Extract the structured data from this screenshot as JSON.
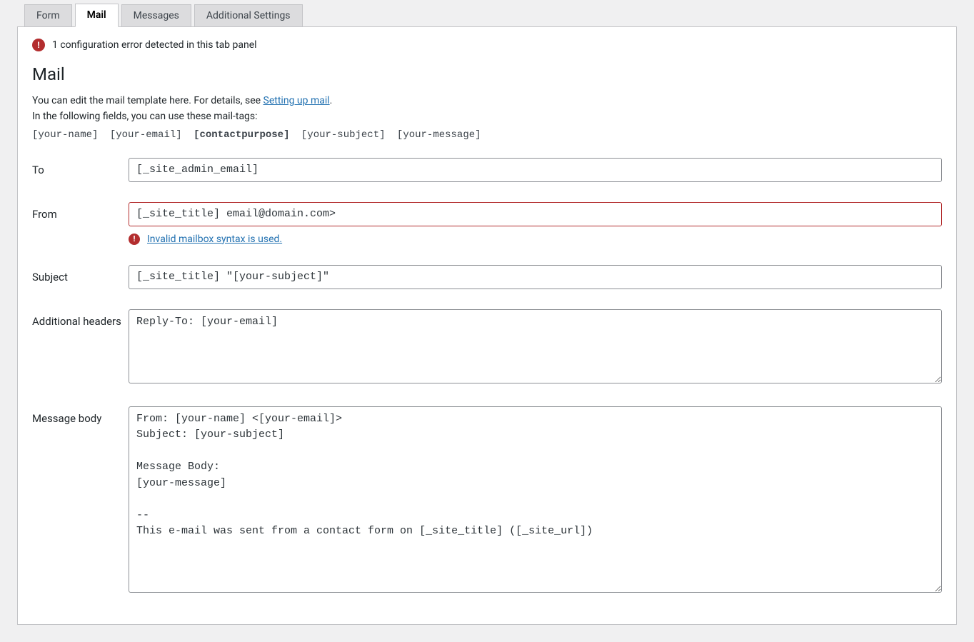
{
  "tabs": [
    {
      "label": "Form",
      "active": false
    },
    {
      "label": "Mail",
      "active": true
    },
    {
      "label": "Messages",
      "active": false
    },
    {
      "label": "Additional Settings",
      "active": false
    }
  ],
  "alert": {
    "text": "1 configuration error detected in this tab panel"
  },
  "section_title": "Mail",
  "intro": {
    "line1_prefix": "You can edit the mail template here. For details, see ",
    "line1_link": "Setting up mail",
    "line1_suffix": ".",
    "line2": "In the following fields, you can use these mail-tags:"
  },
  "mailtags": [
    {
      "tag": "[your-name]",
      "bold": false
    },
    {
      "tag": "[your-email]",
      "bold": false
    },
    {
      "tag": "[contactpurpose]",
      "bold": true
    },
    {
      "tag": "[your-subject]",
      "bold": false
    },
    {
      "tag": "[your-message]",
      "bold": false
    }
  ],
  "fields": {
    "to": {
      "label": "To",
      "value": "[_site_admin_email]"
    },
    "from": {
      "label": "From",
      "value": "[_site_title] email@domain.com>",
      "error": "Invalid mailbox syntax is used."
    },
    "subject": {
      "label": "Subject",
      "value": "[_site_title] \"[your-subject]\""
    },
    "additional_headers": {
      "label": "Additional headers",
      "value": "Reply-To: [your-email]"
    },
    "message_body": {
      "label": "Message body",
      "value": "From: [your-name] <[your-email]>\nSubject: [your-subject]\n\nMessage Body:\n[your-message]\n\n-- \nThis e-mail was sent from a contact form on [_site_title] ([_site_url])"
    }
  }
}
